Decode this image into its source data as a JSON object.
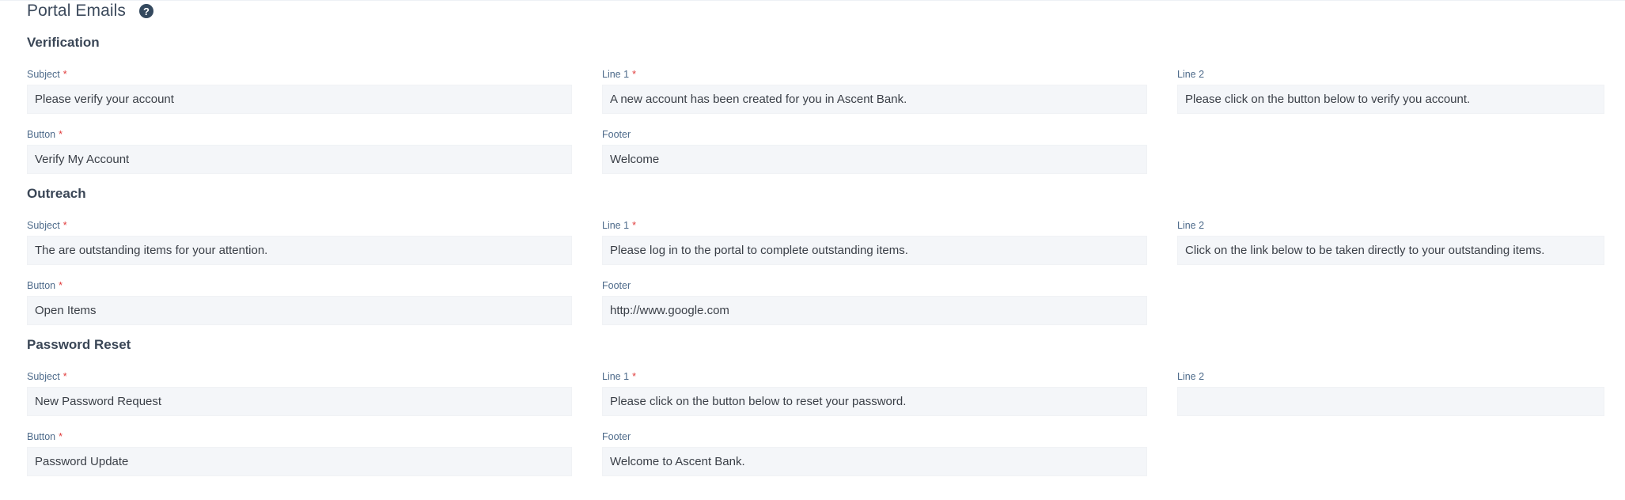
{
  "page": {
    "title": "Portal Emails",
    "help_icon": "question-circle-icon"
  },
  "sections": [
    {
      "title": "Verification",
      "fields": {
        "subject": {
          "label": "Subject",
          "required": "*",
          "value": "Please verify your account"
        },
        "line1": {
          "label": "Line 1",
          "required": "*",
          "value": "A new account has been created for you in Ascent Bank."
        },
        "line2": {
          "label": "Line 2",
          "value": "Please click on the button below to verify you account."
        },
        "button": {
          "label": "Button",
          "required": "*",
          "value": "Verify My Account"
        },
        "footer": {
          "label": "Footer",
          "value": "Welcome"
        }
      }
    },
    {
      "title": "Outreach",
      "fields": {
        "subject": {
          "label": "Subject",
          "required": "*",
          "value": "The are outstanding items for your attention."
        },
        "line1": {
          "label": "Line 1",
          "required": "*",
          "value": "Please log in to the portal to complete outstanding items."
        },
        "line2": {
          "label": "Line 2",
          "value": "Click on the link below to be taken directly to your outstanding items."
        },
        "button": {
          "label": "Button",
          "required": "*",
          "value": "Open Items"
        },
        "footer": {
          "label": "Footer",
          "value": "http://www.google.com"
        }
      }
    },
    {
      "title": "Password Reset",
      "fields": {
        "subject": {
          "label": "Subject",
          "required": "*",
          "value": "New Password Request"
        },
        "line1": {
          "label": "Line 1",
          "required": "*",
          "value": "Please click on the button below to reset your password."
        },
        "line2": {
          "label": "Line 2",
          "value": ""
        },
        "button": {
          "label": "Button",
          "required": "*",
          "value": "Password Update"
        },
        "footer": {
          "label": "Footer",
          "value": "Welcome to Ascent Bank."
        }
      }
    }
  ],
  "colors": {
    "required": "#e03c3c",
    "field_background": "#f4f6f9",
    "label": "#4d6a8a"
  }
}
